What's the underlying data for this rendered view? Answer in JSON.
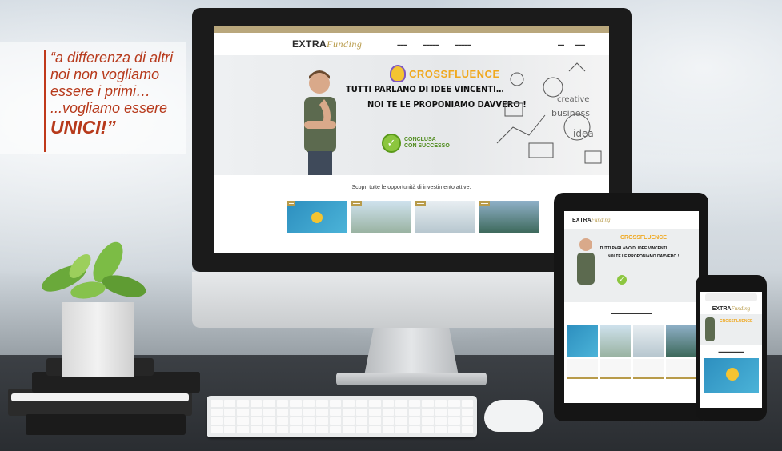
{
  "quote": {
    "lines": [
      "“a differenza di altri",
      "noi non vogliamo",
      "essere i primi…",
      "...vogliamo essere",
      "UNICI!”"
    ]
  },
  "desktop_site": {
    "logo_main": "EXTRA",
    "logo_script": "Funding",
    "hero_brand": "CROSSFLUENCE",
    "tagline_1": "TUTTI PARLANO DI IDEE VINCENTI…",
    "tagline_2": "NOI TE LE PROPONIAMO DAVVERO !",
    "badge_line_1": "CONCLUSA",
    "badge_line_2": "CON SUCCESSO",
    "cta_text": "Scopri tutte le opportunità di investimento attive.",
    "doodle_words": [
      "creative",
      "business",
      "idea"
    ]
  },
  "colors": {
    "quote_red": "#b73a1c",
    "gold": "#b89b4a",
    "brand_orange": "#f0a81e",
    "success_green": "#8cc63f"
  }
}
